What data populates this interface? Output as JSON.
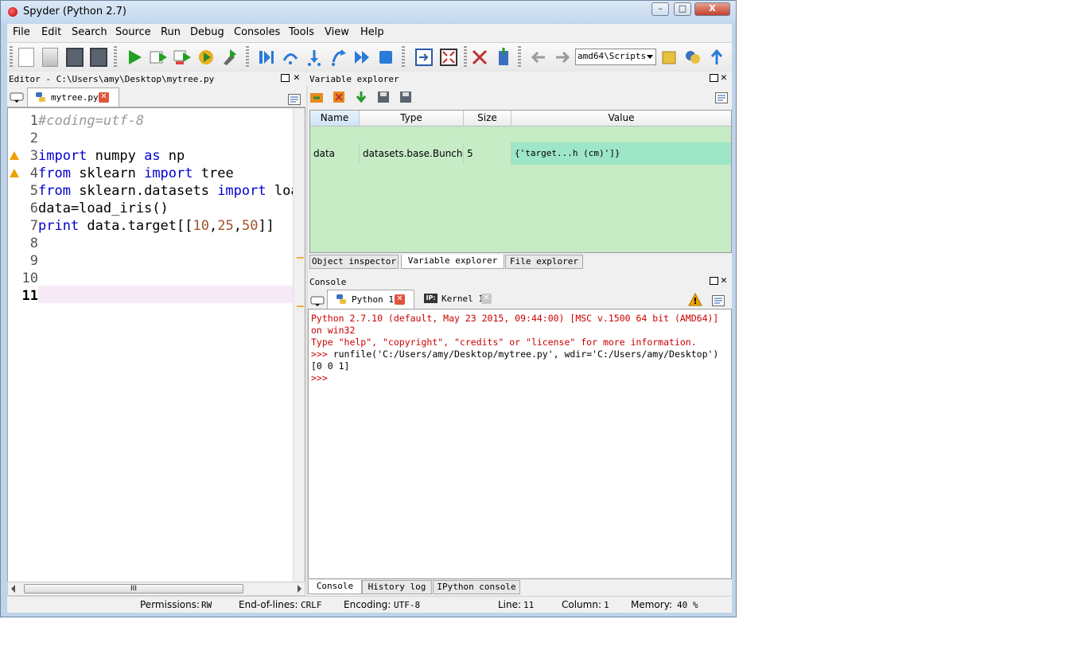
{
  "window": {
    "title": "Spyder (Python 2.7)",
    "controls": {
      "minimize": "–",
      "maximize": "□",
      "close": "X"
    }
  },
  "menu": [
    "File",
    "Edit",
    "Search",
    "Source",
    "Run",
    "Debug",
    "Consoles",
    "Tools",
    "View",
    "Help"
  ],
  "toolbar": {
    "path_combo": "amd64\\Scripts",
    "icons": [
      "new-file-icon",
      "open-file-icon",
      "save-icon",
      "save-all-icon",
      "run-icon",
      "run-cell-icon",
      "run-cell-advance-icon",
      "run-selection-icon",
      "run-config-icon",
      "debug-icon",
      "step-icon",
      "step-into-icon",
      "step-return-icon",
      "continue-icon",
      "stop-debug-icon",
      "maximize-pane-icon",
      "fullscreen-icon",
      "preferences-icon",
      "pythonpath-icon",
      "back-icon",
      "forward-icon",
      "browse-folder-icon",
      "python-path-icon",
      "parent-dir-icon"
    ]
  },
  "editor": {
    "header": "Editor - C:\\Users\\amy\\Desktop\\mytree.py",
    "tab": "mytree.py",
    "lines": [
      {
        "n": "1",
        "parts": [
          {
            "t": "#coding=utf-8",
            "c": "cmt"
          }
        ]
      },
      {
        "n": "2",
        "parts": []
      },
      {
        "n": "3",
        "warn": true,
        "parts": [
          {
            "t": "import",
            "c": "kw"
          },
          {
            "t": " numpy ",
            "c": ""
          },
          {
            "t": "as",
            "c": "kw"
          },
          {
            "t": " np",
            "c": ""
          }
        ]
      },
      {
        "n": "4",
        "warn": true,
        "parts": [
          {
            "t": "from",
            "c": "kw"
          },
          {
            "t": " sklearn ",
            "c": ""
          },
          {
            "t": "import",
            "c": "kw"
          },
          {
            "t": " tree",
            "c": ""
          }
        ]
      },
      {
        "n": "5",
        "parts": [
          {
            "t": "from",
            "c": "kw"
          },
          {
            "t": " sklearn.datasets ",
            "c": ""
          },
          {
            "t": "import",
            "c": "kw"
          },
          {
            "t": " loa",
            "c": ""
          }
        ]
      },
      {
        "n": "6",
        "parts": [
          {
            "t": "data=load_iris()",
            "c": ""
          }
        ]
      },
      {
        "n": "7",
        "parts": [
          {
            "t": "print",
            "c": "kw"
          },
          {
            "t": " data.target[[",
            "c": ""
          },
          {
            "t": "10",
            "c": "num"
          },
          {
            "t": ",",
            "c": ""
          },
          {
            "t": "25",
            "c": "num"
          },
          {
            "t": ",",
            "c": ""
          },
          {
            "t": "50",
            "c": "num"
          },
          {
            "t": "]]",
            "c": ""
          }
        ]
      },
      {
        "n": "8",
        "parts": []
      },
      {
        "n": "9",
        "parts": []
      },
      {
        "n": "10",
        "parts": []
      },
      {
        "n": "11",
        "current": true,
        "parts": []
      }
    ],
    "hscroll_thumb": "III"
  },
  "variable_explorer": {
    "header": "Variable explorer",
    "columns": [
      "Name",
      "Type",
      "Size",
      "Value"
    ],
    "rows": [
      {
        "name": "data",
        "type": "datasets.base.Bunch",
        "size": "5",
        "value": "{'target...h (cm)']}"
      }
    ],
    "tabs": [
      "Object inspector",
      "Variable explorer",
      "File explorer"
    ]
  },
  "console": {
    "header": "Console",
    "tabs": [
      "Python 1",
      "Kernel 1"
    ],
    "lines": [
      {
        "t": "Python 2.7.10 (default, May 23 2015, 09:44:00) [MSC v.1500 64 bit (AMD64)]",
        "c": "red"
      },
      {
        "t": "on win32",
        "c": "red"
      },
      {
        "t": "Type \"help\", \"copyright\", \"credits\" or \"license\" for more information.",
        "c": "red"
      },
      {
        "t": ">>> runfile('C:/Users/amy/Desktop/mytree.py', wdir='C:/Users/amy/Desktop')",
        "c": "mixed"
      },
      {
        "t": "[0 0 1]",
        "c": ""
      },
      {
        "t": ">>> ",
        "c": "red"
      }
    ],
    "bottom_tabs": [
      "Console",
      "History log",
      "IPython console"
    ]
  },
  "status": {
    "permissions_label": "Permissions:",
    "permissions": "RW",
    "eol_label": "End-of-lines:",
    "eol": "CRLF",
    "encoding_label": "Encoding:",
    "encoding": "UTF-8",
    "line_label": "Line:",
    "line": "11",
    "column_label": "Column:",
    "column": "1",
    "memory_label": "Memory:",
    "memory": "40 %"
  },
  "colors": {
    "table_bg": "#c6ecc6",
    "selected_row": "#9ee6c8",
    "keyword": "#0000cc",
    "console_red": "#cc0000"
  }
}
